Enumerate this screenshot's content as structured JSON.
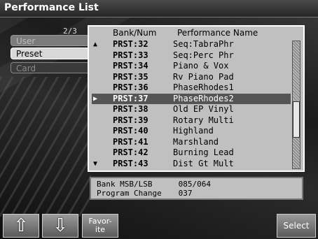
{
  "window": {
    "title": "Performance List"
  },
  "page_indicator": "2/3",
  "tabs": [
    {
      "label": "User"
    },
    {
      "label": "Preset"
    },
    {
      "label": "Card"
    }
  ],
  "list": {
    "headers": {
      "bank_num": "Bank/Num",
      "name": "Performance Name"
    },
    "rows": [
      {
        "marker": "▲",
        "num": "PRST:32",
        "name": "Seq:TabraPhr"
      },
      {
        "marker": "",
        "num": "PRST:33",
        "name": "Seq:Perc Phr"
      },
      {
        "marker": "",
        "num": "PRST:34",
        "name": "Piano & Vox"
      },
      {
        "marker": "",
        "num": "PRST:35",
        "name": "Rv Piano Pad"
      },
      {
        "marker": "",
        "num": "PRST:36",
        "name": "PhaseRhodes1"
      },
      {
        "marker": "▶",
        "num": "PRST:37",
        "name": "PhaseRhodes2",
        "selected": true
      },
      {
        "marker": "",
        "num": "PRST:38",
        "name": "Old EP Vinyl"
      },
      {
        "marker": "",
        "num": "PRST:39",
        "name": "Rotary Multi"
      },
      {
        "marker": "",
        "num": "PRST:40",
        "name": "Highland"
      },
      {
        "marker": "",
        "num": "PRST:41",
        "name": "Marshland"
      },
      {
        "marker": "",
        "num": "PRST:42",
        "name": "Burning Lead"
      },
      {
        "marker": "▼",
        "num": "PRST:43",
        "name": "Dist Gt Mult"
      }
    ]
  },
  "info": {
    "bank_label": "Bank MSB/LSB",
    "bank_value": "085/064",
    "pc_label": "Program Change",
    "pc_value": "037"
  },
  "buttons": {
    "up_icon": "up-arrow-icon",
    "down_icon": "down-arrow-icon",
    "favorite_line1": "Favor-",
    "favorite_line2": "ite",
    "select": "Select"
  }
}
